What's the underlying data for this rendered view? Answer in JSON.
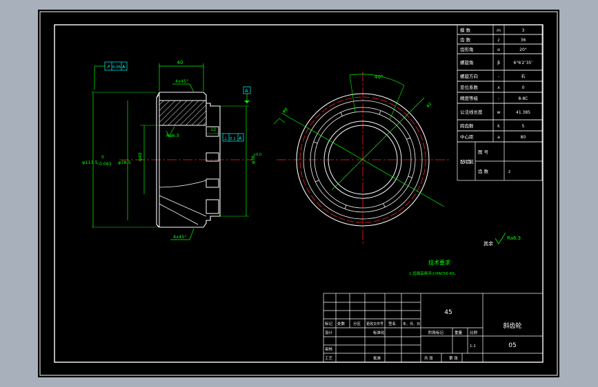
{
  "colors": {
    "background": "#000000",
    "frame": "#ffffff",
    "outline": "#ffffff",
    "dimension": "#00ff00",
    "centerline": "#ff2020",
    "pitch_circle": "#ff2020",
    "datum": "#00ffff",
    "hatch": "#ffffff",
    "text": "#ffffff",
    "title_block_text": "#ffffff"
  },
  "gear_table": {
    "rows": [
      {
        "label": "模 数",
        "symbol": "m",
        "value": "3"
      },
      {
        "label": "齿 数",
        "symbol": "z",
        "value": "36"
      },
      {
        "label": "齿形角",
        "symbol": "α",
        "value": "20°"
      },
      {
        "label": "螺旋角",
        "symbol": "β",
        "value": "6°6′2″35″"
      },
      {
        "label": "螺旋方向",
        "symbol": "-",
        "value": "右"
      },
      {
        "label": "变位系数",
        "symbol": "x",
        "value": "0"
      },
      {
        "label": "精度等级",
        "symbol": "-",
        "value": "8-8C"
      },
      {
        "label": "公法线长度",
        "symbol": "w",
        "value": "41.385"
      },
      {
        "label": "跨齿数",
        "symbol": "k",
        "value": "5"
      },
      {
        "label": "中心距",
        "symbol": "a",
        "value": "80"
      }
    ],
    "mating_label": "配对齿轮",
    "mating_rows": [
      {
        "label": "图 号",
        "value": ""
      },
      {
        "label": "齿 数",
        "value": "z"
      }
    ]
  },
  "front_view": {
    "dims": {
      "width_top": "40",
      "chamfer_top": "4x45°",
      "chamfer_bottom": "4x45°",
      "dia_outer": "φ113.5",
      "dia_outer_tol_1": "0",
      "dia_outer_tol_2": "-0.063",
      "dia_root": "φ78.5",
      "dia_bore": "φ40",
      "dia_hub": "φ36",
      "dia_hub_tol": "+0.0",
      "step_12": "12",
      "roughness_note": "Ra6.3"
    },
    "tolerance_top": {
      "symbol": "↗",
      "value": "0.05",
      "datum": "A"
    },
    "tolerance_mid": {
      "symbol": "⊥",
      "value": "0.1",
      "datum": "A"
    },
    "datum_label": "A"
  },
  "side_view": {
    "angle": "40°",
    "leader_1": "φ8",
    "leader_2": "φ2",
    "leader_3": "Ra6.3"
  },
  "roughness_other": {
    "label": "其余",
    "value": "Ra6.3"
  },
  "requirements": {
    "title": "技术要求",
    "line1": "1.齿面高频淬火HRC56-65。"
  },
  "title_block": {
    "material": "45",
    "part_name": "斜齿轮",
    "drawing_no": "05",
    "header_labels": [
      "标记",
      "处数",
      "分区",
      "更改文件号",
      "签名",
      "年、月、日"
    ],
    "design": "设计",
    "standardize": "标准化",
    "check": "审核",
    "process": "工艺",
    "approve": "批准",
    "stage_label": "阶段标记",
    "weight_label": "重量",
    "scale_label": "比例",
    "scale_value": "1:1",
    "sheet_total": "共  张",
    "sheet_num": "第  张"
  }
}
